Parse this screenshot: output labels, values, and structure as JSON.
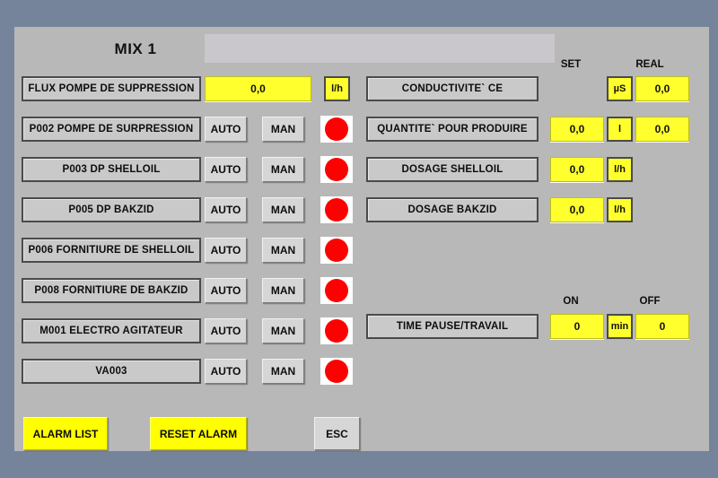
{
  "header": {
    "screen_title": "MIX 1",
    "message_banner": ""
  },
  "colors": {
    "background": "#75849b",
    "panel": "#b8b8b8",
    "plate": "#c9c9c9",
    "value_yellow": "#ffff2e",
    "button_yellow": "#ffff00",
    "lamp_red": "#ff0000",
    "lamp_frame": "#ffffff",
    "text": "#0d0d0d"
  },
  "left_column": {
    "flow_row": {
      "label": "FLUX  POMPE DE SUPPRESSION",
      "value": "0,0",
      "unit": "l/h"
    },
    "device_buttons": {
      "auto_label": "AUTO",
      "man_label": "MAN"
    },
    "devices": [
      {
        "label": "P002 POMPE DE SURPRESSION",
        "auto": "AUTO",
        "man": "MAN",
        "lamp": "#ff0000",
        "lamp_state": "red"
      },
      {
        "label": "P003 DP SHELLOIL",
        "auto": "AUTO",
        "man": "MAN",
        "lamp": "#ff0000",
        "lamp_state": "red"
      },
      {
        "label": "P005 DP BAKZID",
        "auto": "AUTO",
        "man": "MAN",
        "lamp": "#ff0000",
        "lamp_state": "red"
      },
      {
        "label": "P006 FORNITIURE DE SHELLOIL",
        "auto": "AUTO",
        "man": "MAN",
        "lamp": "#ff0000",
        "lamp_state": "red"
      },
      {
        "label": "P008 FORNITIURE DE BAKZID",
        "auto": "AUTO",
        "man": "MAN",
        "lamp": "#ff0000",
        "lamp_state": "red"
      },
      {
        "label": "M001 ELECTRO AGITATEUR",
        "auto": "AUTO",
        "man": "MAN",
        "lamp": "#ff0000",
        "lamp_state": "red"
      },
      {
        "label": "VA003",
        "auto": "AUTO",
        "man": "MAN",
        "lamp": "#ff0000",
        "lamp_state": "red"
      }
    ]
  },
  "right_column": {
    "captions": {
      "set": "SET",
      "real": "REAL",
      "on": "ON",
      "off": "OFF"
    },
    "rows": [
      {
        "label": "CONDUCTIVITE` CE",
        "set": "",
        "unit": "µS",
        "real": "0,0"
      },
      {
        "label": "QUANTITE` POUR PRODUIRE",
        "set": "0,0",
        "unit": "l",
        "real": "0,0"
      },
      {
        "label": "DOSAGE SHELLOIL",
        "set": "0,0",
        "unit": "l/h",
        "real": ""
      },
      {
        "label": "DOSAGE BAKZID",
        "set": "0,0",
        "unit": "l/h",
        "real": ""
      }
    ],
    "timer_row": {
      "label": "TIME PAUSE/TRAVAIL",
      "on_value": "0",
      "unit": "min",
      "off_value": "0"
    }
  },
  "footer": {
    "alarm_list": "ALARM LIST",
    "reset_alarm": "RESET ALARM",
    "esc": "ESC"
  }
}
